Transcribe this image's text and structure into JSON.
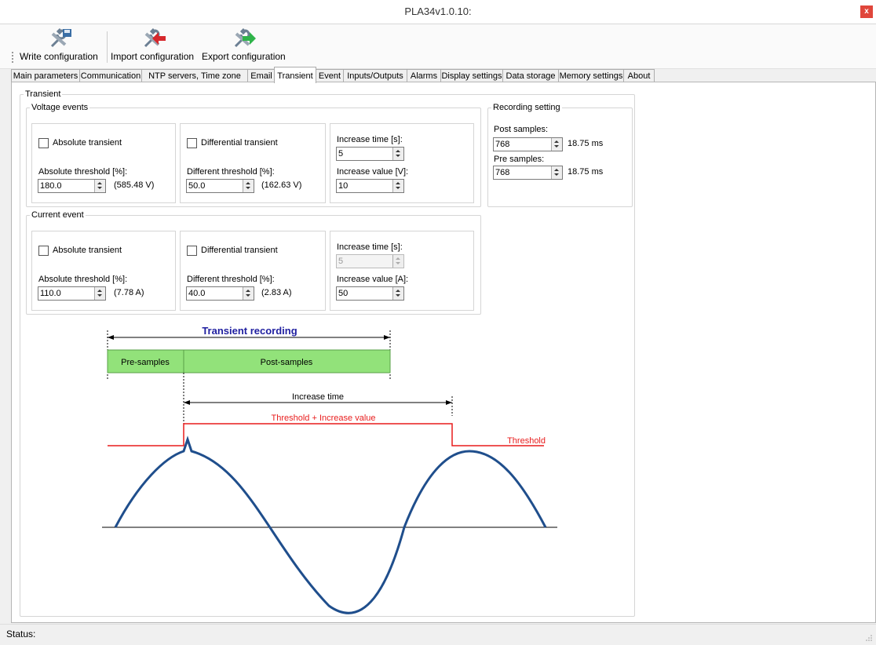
{
  "window": {
    "title": "PLA34v1.0.10:",
    "close_glyph": "x"
  },
  "toolbar": {
    "write_label": "Write configuration",
    "import_label": "Import configuration",
    "export_label": "Export configuration"
  },
  "tabs": [
    "Main parameters",
    "Communication",
    "NTP servers, Time zone",
    "Email",
    "Transient",
    "Event",
    "Inputs/Outputs",
    "Alarms",
    "Display settings",
    "Data storage",
    "Memory settings",
    "About"
  ],
  "active_tab": "Transient",
  "transient": {
    "group_label": "Transient",
    "voltage": {
      "group_label": "Voltage events",
      "absolute_label": "Absolute transient",
      "abs_threshold_label": "Absolute threshold [%]:",
      "abs_threshold_value": "180.0",
      "abs_threshold_calc": "(585.48 V)",
      "differential_label": "Differential transient",
      "diff_threshold_label": "Different threshold [%]:",
      "diff_threshold_value": "50.0",
      "diff_threshold_calc": "(162.63 V)",
      "increase_time_label": "Increase time [s]:",
      "increase_time_value": "5",
      "increase_value_label": "Increase value [V]:",
      "increase_value_value": "10"
    },
    "current": {
      "group_label": "Current event",
      "absolute_label": "Absolute transient",
      "abs_threshold_label": "Absolute threshold [%]:",
      "abs_threshold_value": "110.0",
      "abs_threshold_calc": "(7.78 A)",
      "differential_label": "Differential transient",
      "diff_threshold_label": "Different threshold [%]:",
      "diff_threshold_value": "40.0",
      "diff_threshold_calc": "(2.83 A)",
      "increase_time_label": "Increase time [s]:",
      "increase_time_value": "5",
      "increase_value_label": "Increase value [A]:",
      "increase_value_value": "50"
    },
    "recording": {
      "group_label": "Recording setting",
      "post_label": "Post samples:",
      "post_value": "768",
      "post_ms": "18.75 ms",
      "pre_label": "Pre samples:",
      "pre_value": "768",
      "pre_ms": "18.75 ms"
    },
    "diagram": {
      "title": "Transient recording",
      "pre_samples": "Pre-samples",
      "post_samples": "Post-samples",
      "increase_time": "Increase time",
      "threshold_increase": "Threshold + Increase value",
      "threshold": "Threshold",
      "colors": {
        "title": "#1f1fa0",
        "bar": "#92e27a",
        "threshold": "#e81c1c",
        "wave": "#1f4e8c"
      }
    }
  },
  "status": {
    "label": "Status:"
  }
}
